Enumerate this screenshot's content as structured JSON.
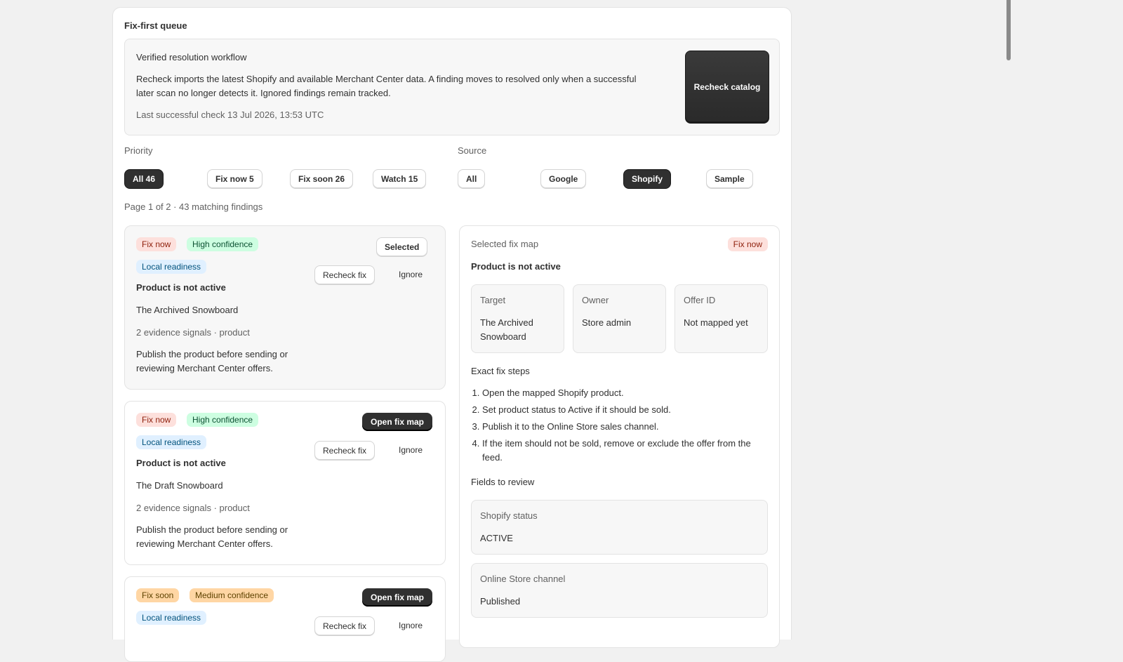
{
  "queue": {
    "title": "Fix-first queue",
    "workflow": {
      "heading": "Verified resolution workflow",
      "description": "Recheck imports the latest Shopify and available Merchant Center data. A finding moves to resolved only when a successful later scan no longer detects it. Ignored findings remain tracked.",
      "last_check": "Last successful check 13 Jul 2026, 13:53 UTC",
      "button": "Recheck catalog"
    },
    "priority": {
      "label": "Priority",
      "options": [
        "All 46",
        "Fix now 5",
        "Fix soon 26",
        "Watch 15"
      ],
      "selected": "All 46"
    },
    "source": {
      "label": "Source",
      "options": [
        "All",
        "Google",
        "Shopify",
        "Sample"
      ],
      "selected": "Shopify"
    },
    "pagination": "Page 1 of 2 · 43 matching findings"
  },
  "findings": [
    {
      "priority": "Fix now",
      "confidence": "High confidence",
      "category": "Local readiness",
      "title": "Product is not active",
      "product": "The Archived Snowboard",
      "evidence": "2 evidence signals · product",
      "advice": "Publish the product before sending or reviewing Merchant Center offers.",
      "action": "Selected",
      "recheck": "Recheck fix",
      "ignore": "Ignore"
    },
    {
      "priority": "Fix now",
      "confidence": "High confidence",
      "category": "Local readiness",
      "title": "Product is not active",
      "product": "The Draft Snowboard",
      "evidence": "2 evidence signals · product",
      "advice": "Publish the product before sending or reviewing Merchant Center offers.",
      "action": "Open fix map",
      "recheck": "Recheck fix",
      "ignore": "Ignore"
    },
    {
      "priority": "Fix soon",
      "confidence": "Medium confidence",
      "category": "Local readiness",
      "action": "Open fix map",
      "recheck": "Recheck fix",
      "ignore": "Ignore"
    }
  ],
  "fix_map": {
    "heading": "Selected fix map",
    "badge": "Fix now",
    "title": "Product is not active",
    "target": {
      "label": "Target",
      "value": "The Archived Snowboard"
    },
    "owner": {
      "label": "Owner",
      "value": "Store admin"
    },
    "offer": {
      "label": "Offer ID",
      "value": "Not mapped yet"
    },
    "steps_heading": "Exact fix steps",
    "steps": [
      "Open the mapped Shopify product.",
      "Set product status to Active if it should be sold.",
      "Publish it to the Online Store sales channel.",
      "If the item should not be sold, remove or exclude the offer from the feed."
    ],
    "fields_heading": "Fields to review",
    "fields": [
      {
        "label": "Shopify status",
        "value": "ACTIVE"
      },
      {
        "label": "Online Store channel",
        "value": "Published"
      }
    ]
  },
  "colors": {
    "fix_now_bg": "#fde0dc",
    "high_conf_bg": "#cdfee1",
    "fix_soon_bg": "#ffd6a4",
    "readiness_bg": "#e0f0ff",
    "primary": "#303030"
  }
}
